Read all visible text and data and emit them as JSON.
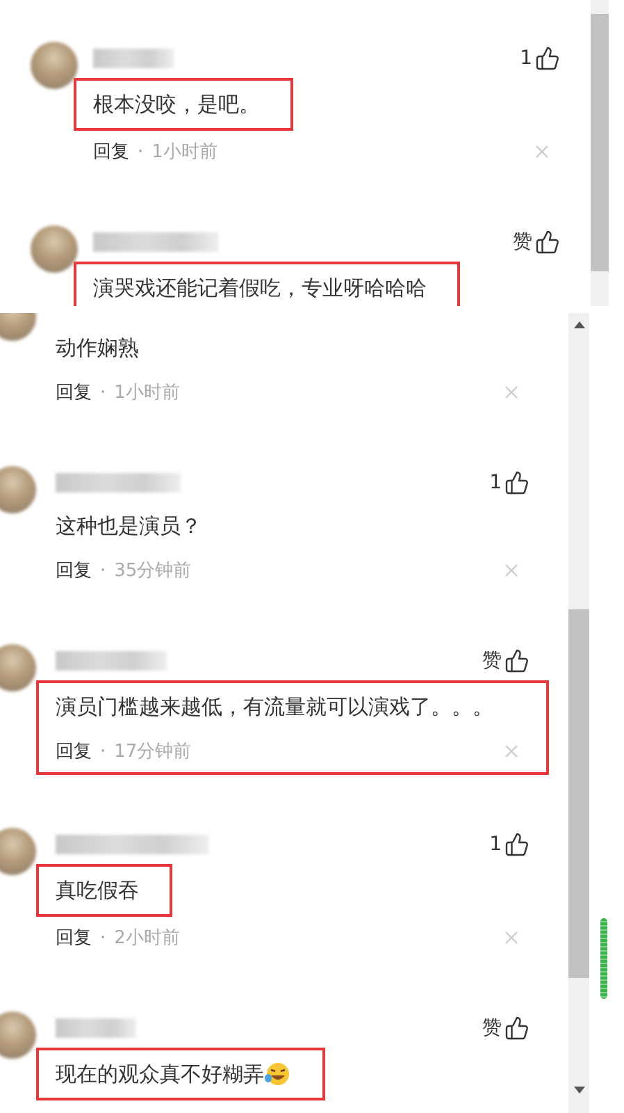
{
  "panels": [
    {
      "comments": [
        {
          "kind": "full",
          "like": "1",
          "text": "根本没咬，是吧。",
          "reply": "回复",
          "separator": "·",
          "time": "1小时前",
          "highlighted": true,
          "meta_highlighted": false,
          "emoji": false
        },
        {
          "kind": "full",
          "like": "赞",
          "text": "演哭戏还能记着假吃，专业呀哈哈哈",
          "highlighted": true,
          "emoji": false
        }
      ]
    },
    {
      "comments": [
        {
          "kind": "partial",
          "text": "动作娴熟",
          "reply": "回复",
          "separator": "·",
          "time": "1小时前",
          "highlighted": false,
          "meta_highlighted": false,
          "emoji": false
        },
        {
          "kind": "full",
          "like": "1",
          "text": "这种也是演员？",
          "reply": "回复",
          "separator": "·",
          "time": "35分钟前",
          "highlighted": false,
          "meta_highlighted": false,
          "emoji": false
        },
        {
          "kind": "full",
          "like": "赞",
          "text": "演员门槛越来越低，有流量就可以演戏了。。。",
          "reply": "回复",
          "separator": "·",
          "time": "17分钟前",
          "highlighted": true,
          "meta_highlighted": true,
          "emoji": false
        },
        {
          "kind": "full",
          "like": "1",
          "text": "真吃假吞",
          "reply": "回复",
          "separator": "·",
          "time": "2小时前",
          "highlighted": true,
          "meta_highlighted": false,
          "emoji": false
        },
        {
          "kind": "full",
          "like": "赞",
          "text": "现在的观众真不好糊弄",
          "highlighted": true,
          "emoji": true
        }
      ]
    }
  ]
}
